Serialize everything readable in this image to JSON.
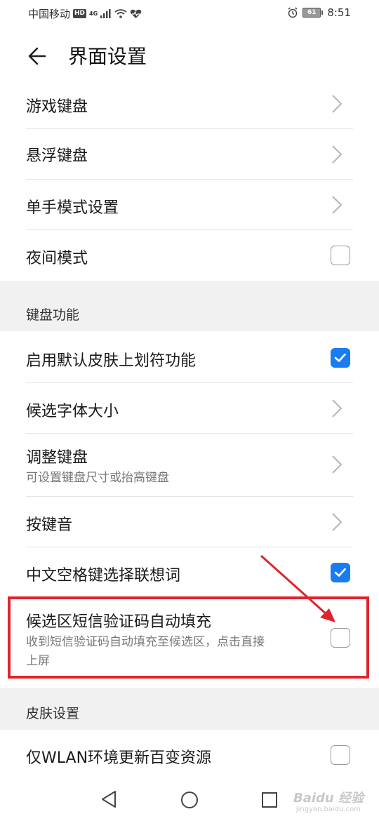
{
  "status": {
    "carrier": "中国移动",
    "hd": "HD",
    "net": "4G",
    "battery": "61",
    "time": "8:51"
  },
  "header": {
    "title": "界面设置"
  },
  "rows": [
    {
      "label": "游戏键盘"
    },
    {
      "label": "悬浮键盘"
    },
    {
      "label": "单手模式设置"
    },
    {
      "label": "夜间模式"
    },
    {
      "label": "启用默认皮肤上划符功能"
    },
    {
      "label": "候选字体大小"
    },
    {
      "label": "调整键盘",
      "sub": "可设置键盘尺寸或抬高键盘"
    },
    {
      "label": "按键音"
    },
    {
      "label": "中文空格键选择联想词"
    },
    {
      "label": "候选区短信验证码自动填充",
      "sub1": "收到短信验证码自动填充至候选区，点击直接",
      "sub2": "上屏"
    },
    {
      "label": "仅WLAN环境更新百变资源"
    }
  ],
  "sections": {
    "keyboard": "键盘功能",
    "skin": "皮肤设置"
  },
  "checkboxes": {
    "night_mode": false,
    "swipe_symbols": true,
    "space_select": true,
    "sms_autofill": false,
    "wlan_update": false
  },
  "colors": {
    "accent": "#1a7cf2",
    "annotation": "#e0242c"
  },
  "watermark": {
    "brand": "Baidu 经验",
    "url": "jingyan.baidu.com"
  }
}
